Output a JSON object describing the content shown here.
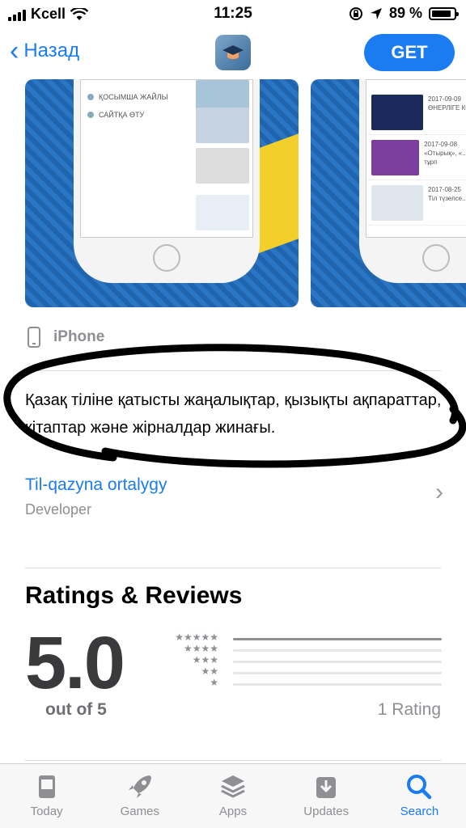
{
  "status_bar": {
    "carrier": "Kcell",
    "time": "11:25",
    "battery_percent": "89 %",
    "battery_level": 0.89
  },
  "nav": {
    "back_label": "Назад",
    "get_label": "GET"
  },
  "screenshots": {
    "left_menu": [
      "ҚОСЫМША ЖАЙЛЫ",
      "САЙТҚА ӨТУ"
    ],
    "right_items": [
      {
        "date": "2017-09-09",
        "title": "ӨНЕРЛІГЕ КӨ"
      },
      {
        "date": "2017-09-08",
        "title": "«Отырық», «... құлаққа тұрп"
      },
      {
        "date": "2017-08-25",
        "title": "Тіл түзелсе..."
      }
    ]
  },
  "device_label": "iPhone",
  "description": "Қазақ тіліне қатысты жаңалықтар, қызықты ақпараттар, кітаптар және жірналдар жинағы.",
  "developer": {
    "name": "Til-qazyna ortalygy",
    "label": "Developer"
  },
  "ratings": {
    "title": "Ratings & Reviews",
    "score": "5.0",
    "out_of": "out of 5",
    "count_label": "1 Rating",
    "distribution": [
      {
        "stars": 5,
        "stars_glyph": "★★★★★",
        "fraction": 1.0
      },
      {
        "stars": 4,
        "stars_glyph": "★★★★",
        "fraction": 0.0
      },
      {
        "stars": 3,
        "stars_glyph": "★★★",
        "fraction": 0.0
      },
      {
        "stars": 2,
        "stars_glyph": "★★",
        "fraction": 0.0
      },
      {
        "stars": 1,
        "stars_glyph": "★",
        "fraction": 0.0
      }
    ]
  },
  "tab_bar": {
    "tabs": [
      {
        "label": "Today",
        "icon": "today-icon",
        "active": false
      },
      {
        "label": "Games",
        "icon": "rocket-icon",
        "active": false
      },
      {
        "label": "Apps",
        "icon": "stack-icon",
        "active": false
      },
      {
        "label": "Updates",
        "icon": "download-icon",
        "active": false
      },
      {
        "label": "Search",
        "icon": "search-icon",
        "active": true
      }
    ]
  },
  "colors": {
    "accent": "#1a7cf0",
    "secondary_text": "#8e8e93",
    "annotation_circle": "#000000"
  }
}
